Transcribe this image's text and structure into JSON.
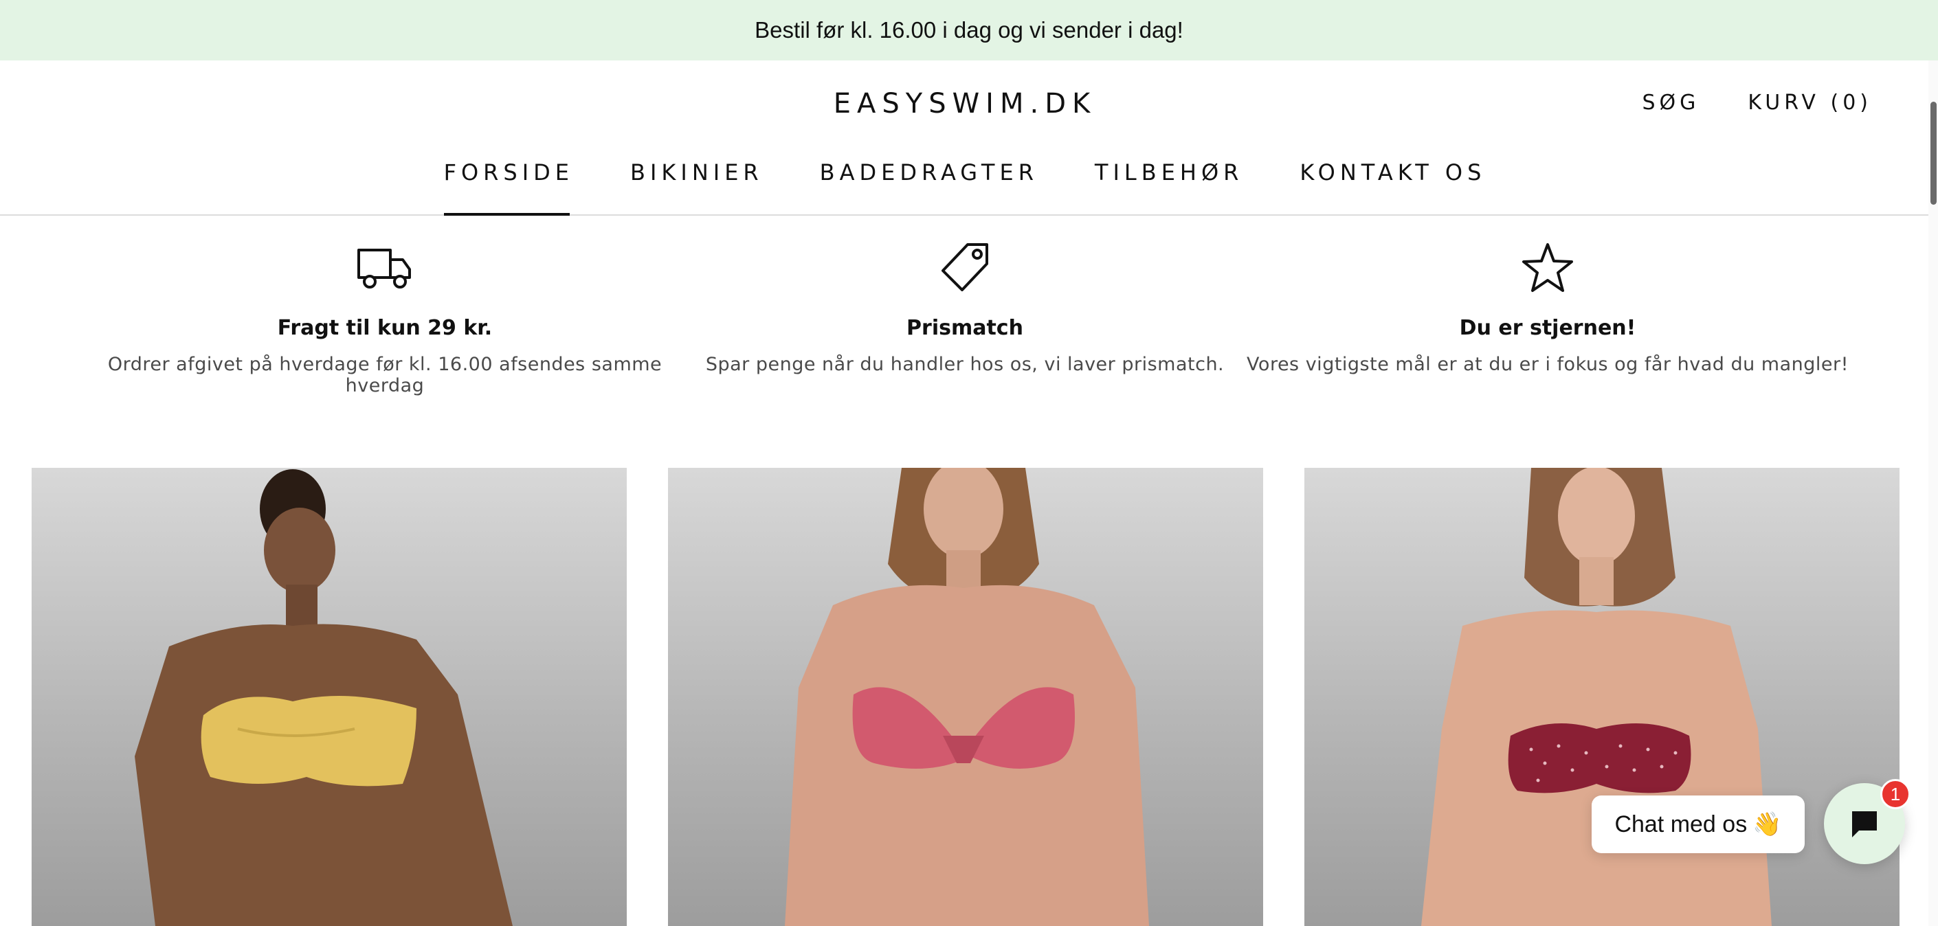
{
  "announcement": {
    "text": "Bestil før kl. 16.00 i dag og vi sender i dag!"
  },
  "header": {
    "logo": "EASYSWIM.DK",
    "search_label": "SØG",
    "cart_label": "KURV (0)"
  },
  "nav": {
    "items": [
      {
        "label": "FORSIDE",
        "active": true
      },
      {
        "label": "BIKINIER",
        "active": false
      },
      {
        "label": "BADEDRAGTER",
        "active": false
      },
      {
        "label": "TILBEHØR",
        "active": false
      },
      {
        "label": "KONTAKT OS",
        "active": false
      }
    ]
  },
  "features": [
    {
      "icon": "truck-icon",
      "title": "Fragt til kun 29 kr.",
      "description": "Ordrer afgivet på hverdage før kl. 16.00 afsendes samme hverdag"
    },
    {
      "icon": "price-tag-icon",
      "title": "Prismatch",
      "description": "Spar penge når du handler hos os, vi laver prismatch."
    },
    {
      "icon": "star-icon",
      "title": "Du er stjernen!",
      "description": "Vores vigtigste mål er at du er i fokus og får hvad du mangler!"
    }
  ],
  "products": [
    {
      "image": "yellow-bandeau-bikini-photo",
      "accent": "#e3c15d"
    },
    {
      "image": "pink-bow-bikini-photo",
      "accent": "#d25a6e"
    },
    {
      "image": "burgundy-dot-bandeau-bikini-photo",
      "accent": "#8a1f34"
    }
  ],
  "chat": {
    "label": "Chat med os",
    "emoji": "👋",
    "badge_count": "1"
  },
  "colors": {
    "announcement_bg": "#e3f4e4",
    "text": "#111111",
    "badge": "#e8342f"
  }
}
